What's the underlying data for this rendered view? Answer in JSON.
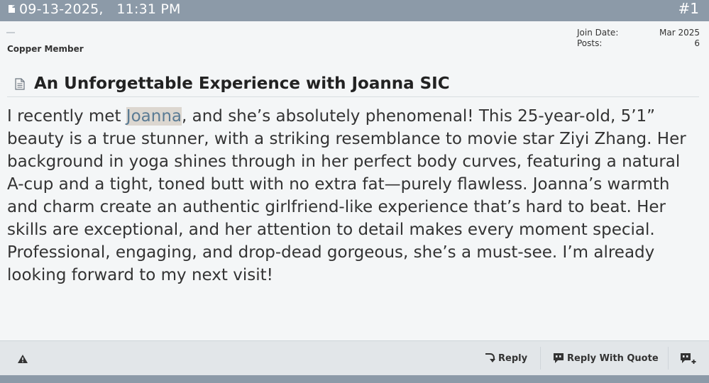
{
  "post": {
    "date": "09-13-2025,",
    "time": "11:31 PM",
    "number": "#1",
    "icon": "document-icon"
  },
  "user": {
    "rank": "Copper Member",
    "join_date_label": "Join Date:",
    "join_date_value": "Mar 2025",
    "posts_label": "Posts:",
    "posts_value": "6"
  },
  "title": {
    "icon": "post-icon",
    "text": "An Unforgettable Experience with Joanna SIC"
  },
  "body": {
    "before": "I recently met ",
    "highlight": "Joanna",
    "after": ", and she’s absolutely phenomenal! This 25-year-old, 5’1” beauty is a true stunner, with a striking resemblance to movie star Ziyi Zhang. Her background in yoga shines through in her perfect body curves, featuring a natural A-cup and a tight, toned butt with no extra fat—purely flawless. Joanna’s warmth and charm create an authentic girlfriend-like experience that’s hard to beat. Her skills are exceptional, and her attention to detail makes every moment special. Professional, engaging, and drop-dead gorgeous, she’s a must-see. I’m already looking forward to my next visit!",
    "highlight_color": "#dcd7d0"
  },
  "footer": {
    "report_icon": "warning-icon",
    "reply_label": "Reply",
    "reply_quote_label": "Reply With Quote",
    "multiquote_icon": "multi-quote-icon"
  },
  "colors": {
    "header_bar": "#8c9aa8",
    "post_background": "#f4f6f7",
    "footer_background": "#e2e6e9"
  }
}
